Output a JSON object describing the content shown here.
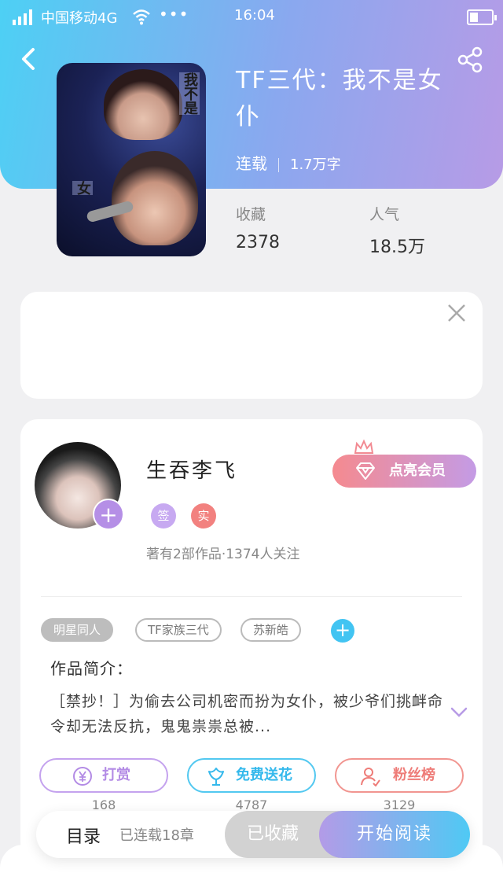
{
  "status_bar": {
    "carrier": "中国移动4G",
    "more": "•••",
    "time": "16:04"
  },
  "book": {
    "title": "TF三代：我不是女仆",
    "status": "连载",
    "word_count": "1.7万字"
  },
  "cover": {
    "text_top": "我不是",
    "text_bottom": "女"
  },
  "stats": {
    "collect_label": "收藏",
    "collect_value": "2378",
    "popularity_label": "人气",
    "popularity_value": "18.5万"
  },
  "author": {
    "name": "生吞李飞",
    "badge_sign": "签",
    "badge_real": "实",
    "meta": "著有2部作品·1374人关注",
    "follow_symbol": "+"
  },
  "vip_button": {
    "label": "点亮会员"
  },
  "tags": {
    "items": [
      "明星同人",
      "TF家族三代",
      "苏新皓"
    ],
    "add_symbol": "+"
  },
  "intro": {
    "label": "作品简介：",
    "text": "［禁抄！］为偷去公司机密而扮为女仆，被少爷们挑衅命令却无法反抗，鬼鬼祟祟总被..."
  },
  "actions": {
    "reward": {
      "label": "打赏",
      "count": "168"
    },
    "flower": {
      "label": "免费送花",
      "count": "4787"
    },
    "fans": {
      "label": "粉丝榜",
      "count": "3129"
    }
  },
  "bottom_bar": {
    "toc_label": "目录",
    "chapters": "已连载18章",
    "collected_label": "已收藏",
    "read_label": "开始阅读"
  },
  "colors": {
    "header_gradient": [
      "#4dd0f4",
      "#b79be6"
    ],
    "purple": "#b38be5",
    "blue": "#35b9ec",
    "coral": "#ee7c78"
  },
  "icons": [
    "signal-icon",
    "wifi-icon",
    "battery-icon",
    "back-icon",
    "share-icon",
    "close-icon",
    "crown-icon",
    "diamond-icon",
    "yen-icon",
    "flower-icon",
    "person-icon",
    "chevron-down-icon"
  ]
}
